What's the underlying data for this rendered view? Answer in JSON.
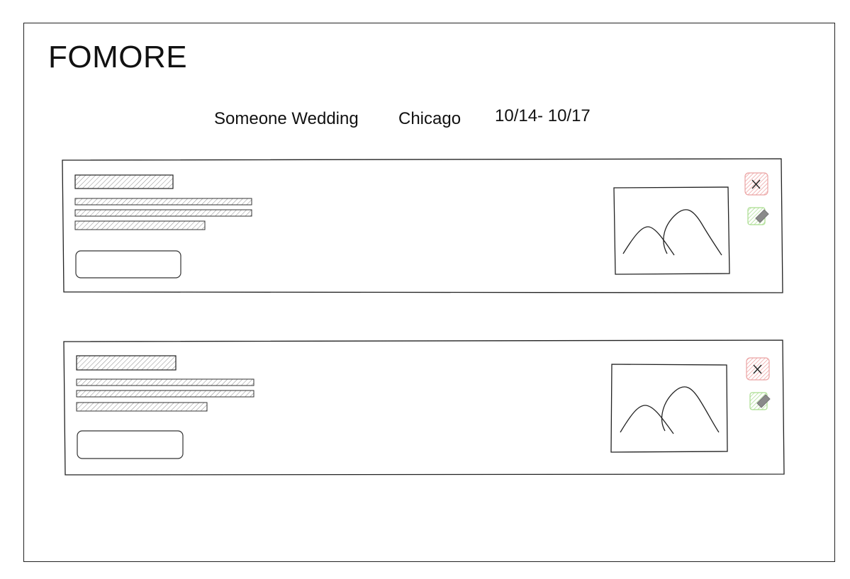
{
  "app": {
    "logo": "FOMORE"
  },
  "event": {
    "title": "Someone Wedding",
    "city": "Chicago",
    "dates": "10/14- 10/17"
  },
  "cards": [
    {
      "id": "card-1",
      "image_icon": "mountain-image-icon",
      "delete_icon": "close-icon",
      "edit_icon": "edit-pencil-icon"
    },
    {
      "id": "card-2",
      "image_icon": "mountain-image-icon",
      "delete_icon": "close-icon",
      "edit_icon": "edit-pencil-icon"
    }
  ],
  "colors": {
    "delete_fill": "#f4b9b9",
    "delete_stroke": "#e48a8a",
    "edit_fill": "#c9edb4",
    "edit_stroke": "#9fd486",
    "hatch": "#888888",
    "line": "#222222"
  }
}
